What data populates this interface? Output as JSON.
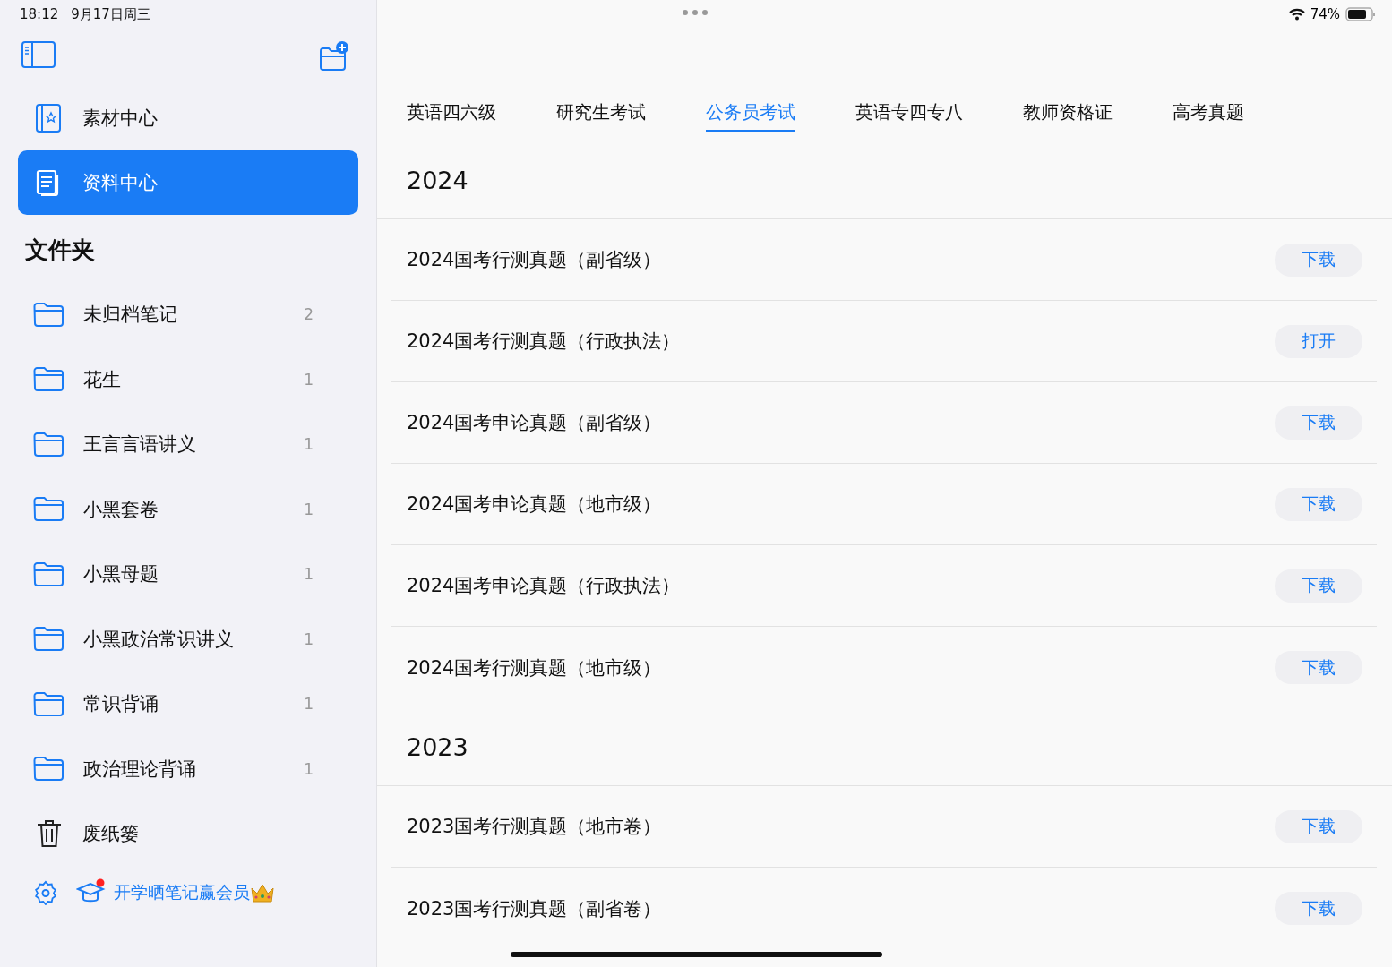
{
  "status_bar": {
    "time": "18:12",
    "date": "9月17日周三",
    "battery_text": "74%"
  },
  "sidebar": {
    "nav": [
      {
        "label": "素材中心",
        "selected": false
      },
      {
        "label": "资料中心",
        "selected": true
      }
    ],
    "folders_title": "文件夹",
    "folders": [
      {
        "kind": "folder",
        "name": "未归档笔记",
        "count": "2"
      },
      {
        "kind": "folder",
        "name": "花生",
        "count": "1"
      },
      {
        "kind": "folder",
        "name": "王言言语讲义",
        "count": "1"
      },
      {
        "kind": "folder",
        "name": "小黑套卷",
        "count": "1"
      },
      {
        "kind": "folder",
        "name": "小黑母题",
        "count": "1"
      },
      {
        "kind": "folder",
        "name": "小黑政治常识讲义",
        "count": "1"
      },
      {
        "kind": "folder",
        "name": "常识背诵",
        "count": "1"
      },
      {
        "kind": "folder",
        "name": "政治理论背诵",
        "count": "1"
      },
      {
        "kind": "trash",
        "name": "废纸篓"
      }
    ],
    "promo": {
      "text": "开学晒笔记赢会员",
      "badge": true
    }
  },
  "tabs": [
    {
      "label": "英语四六级",
      "selected": false
    },
    {
      "label": "研究生考试",
      "selected": false
    },
    {
      "label": "公务员考试",
      "selected": true
    },
    {
      "label": "英语专四专八",
      "selected": false
    },
    {
      "label": "教师资格证",
      "selected": false
    },
    {
      "label": "高考真题",
      "selected": false
    }
  ],
  "sections": [
    {
      "year": "2024",
      "items": [
        {
          "title": "2024国考行测真题（副省级）",
          "action": "下载"
        },
        {
          "title": "2024国考行测真题（行政执法）",
          "action": "打开"
        },
        {
          "title": "2024国考申论真题（副省级）",
          "action": "下载"
        },
        {
          "title": "2024国考申论真题（地市级）",
          "action": "下载"
        },
        {
          "title": "2024国考申论真题（行政执法）",
          "action": "下载"
        },
        {
          "title": "2024国考行测真题（地市级）",
          "action": "下载"
        }
      ]
    },
    {
      "year": "2023",
      "items": [
        {
          "title": "2023国考行测真题（地市卷）",
          "action": "下载"
        },
        {
          "title": "2023国考行测真题（副省卷）",
          "action": "下载"
        }
      ]
    }
  ]
}
